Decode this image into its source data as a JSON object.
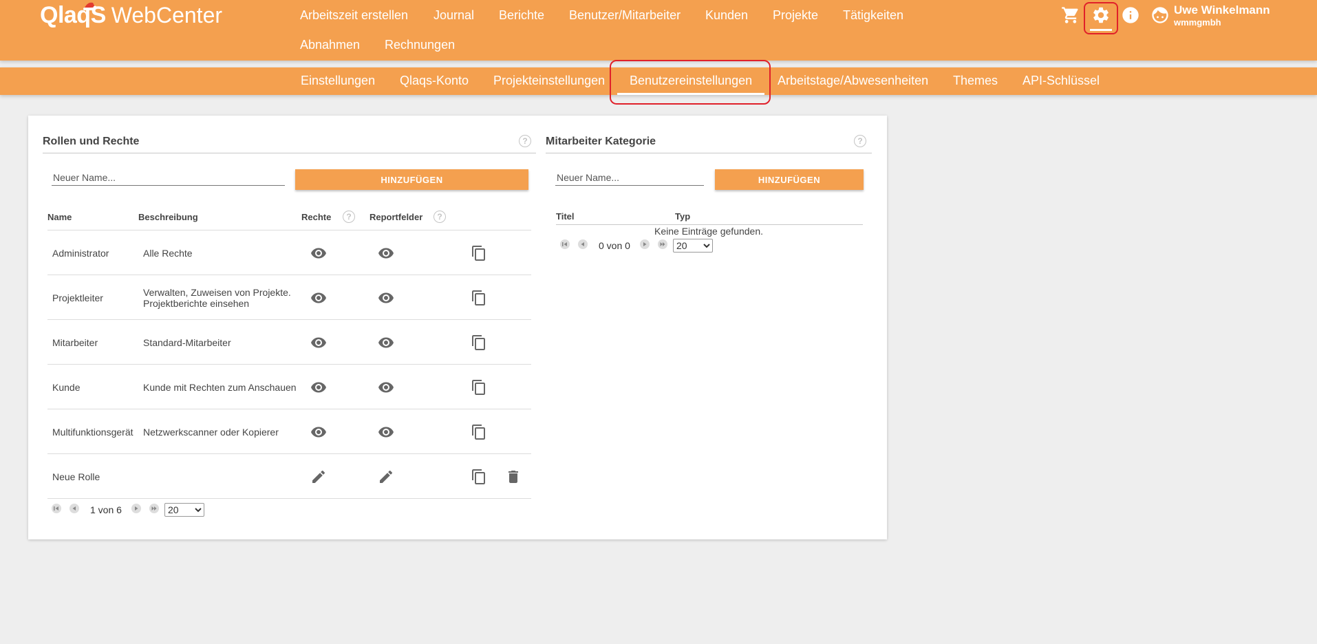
{
  "header": {
    "logo_brand": "QlaqS",
    "logo_product": "WebCenter",
    "nav": [
      {
        "label": "Arbeitszeit erstellen"
      },
      {
        "label": "Journal"
      },
      {
        "label": "Berichte"
      },
      {
        "label": "Benutzer/Mitarbeiter"
      },
      {
        "label": "Kunden"
      },
      {
        "label": "Projekte"
      },
      {
        "label": "Tätigkeiten"
      },
      {
        "label": "Abnahmen"
      },
      {
        "label": "Rechnungen"
      }
    ],
    "icons": [
      "cart-icon",
      "gear-icon",
      "info-icon",
      "user-face-icon"
    ],
    "user_name": "Uwe Winkelmann",
    "user_company": "wmmgmbh",
    "brand_color": "#f4a04f",
    "highlight_color": "#e0202a"
  },
  "subnav": {
    "items": [
      {
        "label": "Einstellungen"
      },
      {
        "label": "Qlaqs-Konto"
      },
      {
        "label": "Projekteinstellungen"
      },
      {
        "label": "Benutzereinstellungen"
      },
      {
        "label": "Arbeitstage/Abwesenheiten"
      },
      {
        "label": "Themes"
      },
      {
        "label": "API-Schlüssel"
      }
    ],
    "active": "Benutzereinstellungen"
  },
  "roles": {
    "title": "Rollen und Rechte",
    "help": "?",
    "input_placeholder": "Neuer Name...",
    "add_label": "HINZUFÜGEN",
    "columns": {
      "name": "Name",
      "description": "Beschreibung",
      "rights": "Rechte",
      "report_fields": "Reportfelder"
    },
    "rows": [
      {
        "name": "Administrator",
        "description": "Alle Rechte",
        "mode": "view"
      },
      {
        "name": "Projektleiter",
        "description": "Verwalten, Zuweisen von Projekte. Projektberichte einsehen",
        "mode": "view"
      },
      {
        "name": "Mitarbeiter",
        "description": "Standard-Mitarbeiter",
        "mode": "view"
      },
      {
        "name": "Kunde",
        "description": "Kunde mit Rechten zum Anschauen",
        "mode": "view"
      },
      {
        "name": "Multifunktionsgerät",
        "description": "Netzwerkscanner oder Kopierer",
        "mode": "view"
      },
      {
        "name": "Neue Rolle",
        "description": "",
        "mode": "edit"
      }
    ],
    "pagination": {
      "text": "1 von 6",
      "page_size": "20",
      "page_size_options": [
        "20"
      ]
    }
  },
  "categories": {
    "title": "Mitarbeiter Kategorie",
    "help": "?",
    "input_placeholder": "Neuer Name...",
    "add_label": "HINZUFÜGEN",
    "columns": {
      "title": "Titel",
      "type": "Typ"
    },
    "empty_text": "Keine Einträge gefunden.",
    "pagination": {
      "text": "0 von 0",
      "page_size": "20",
      "page_size_options": [
        "20"
      ]
    }
  }
}
